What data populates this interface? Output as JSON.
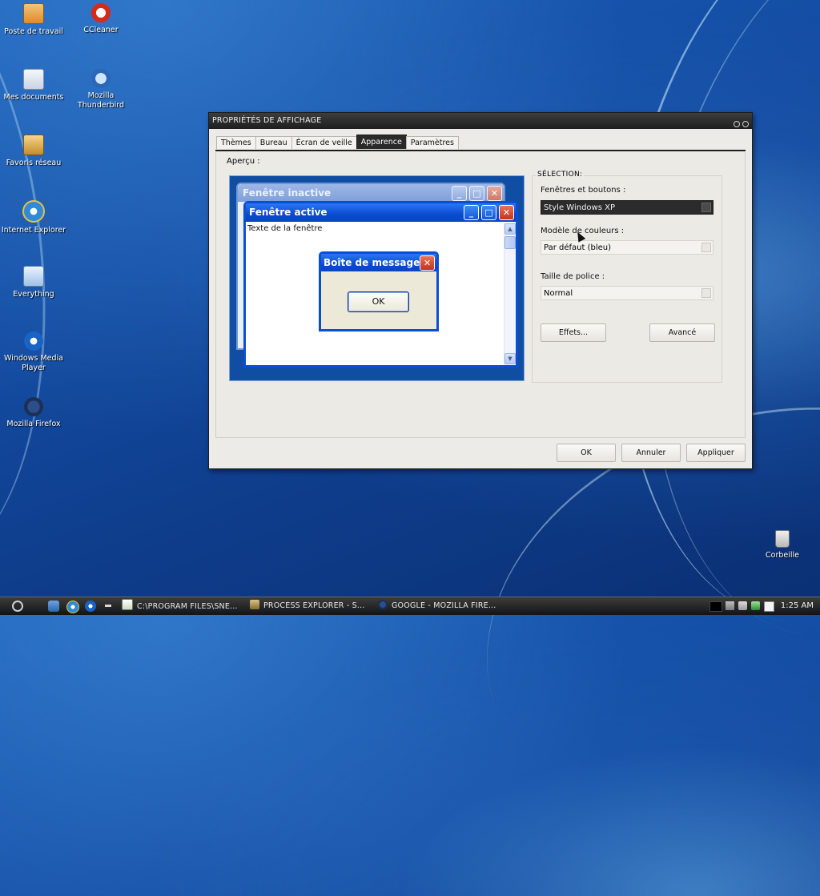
{
  "desktop": {
    "icons": [
      {
        "label": "Poste de travail",
        "icon": "computer-icon"
      },
      {
        "label": "CCleaner",
        "icon": "ccleaner-icon"
      },
      {
        "label": "Mes documents",
        "icon": "documents-folder-icon"
      },
      {
        "label": "Mozilla Thunderbird",
        "icon": "thunderbird-icon"
      },
      {
        "label": "Favoris réseau",
        "icon": "network-places-icon"
      },
      {
        "label": "Internet Explorer",
        "icon": "internet-explorer-icon"
      },
      {
        "label": "Everything",
        "icon": "everything-search-icon"
      },
      {
        "label": "Windows Media Player",
        "icon": "media-player-icon"
      },
      {
        "label": "Mozilla Firefox",
        "icon": "firefox-icon"
      },
      {
        "label": "Corbeille",
        "icon": "recycle-bin-icon"
      }
    ]
  },
  "dialog": {
    "title": "PROPRIÉTÉS DE AFFICHAGE",
    "tabs": [
      {
        "label": "Thèmes",
        "active": false
      },
      {
        "label": "Bureau",
        "active": false
      },
      {
        "label": "Écran de veille",
        "active": false
      },
      {
        "label": "Apparence",
        "active": true
      },
      {
        "label": "Paramètres",
        "active": false
      }
    ],
    "preview": {
      "label": "Aperçu :",
      "inactive_window_title": "Fenêtre inactive",
      "active_window_title": "Fenêtre active",
      "window_text": "Texte de la fenêtre",
      "message_box_title": "Boîte de message",
      "message_ok": "OK"
    },
    "selection": {
      "group_label": "SÉLECTION:",
      "windows_buttons_label": "Fenêtres et boutons :",
      "windows_buttons_value": "Style Windows XP",
      "color_scheme_label": "Modèle de couleurs :",
      "color_scheme_value": "Par défaut (bleu)",
      "font_size_label": "Taille de police :",
      "font_size_value": "Normal",
      "effects_button": "Effets...",
      "advanced_button": "Avancé"
    },
    "buttons": {
      "ok": "OK",
      "cancel": "Annuler",
      "apply": "Appliquer"
    }
  },
  "taskbar": {
    "tasks": [
      {
        "label": "C:\\PROGRAM FILES\\SNE...",
        "icon": "notepad-icon"
      },
      {
        "label": "PROCESS EXPLORER - S...",
        "icon": "process-explorer-icon"
      },
      {
        "label": "GOOGLE - MOZILLA FIRE...",
        "icon": "firefox-icon"
      }
    ],
    "clock": "1:25 AM"
  },
  "colors": {
    "desktop_blue": "#1550a8",
    "xp_titlebar_blue": "#0a4bd0",
    "dialog_title_dark": "#1e1e1e",
    "taskbar_dark": "#141414"
  }
}
